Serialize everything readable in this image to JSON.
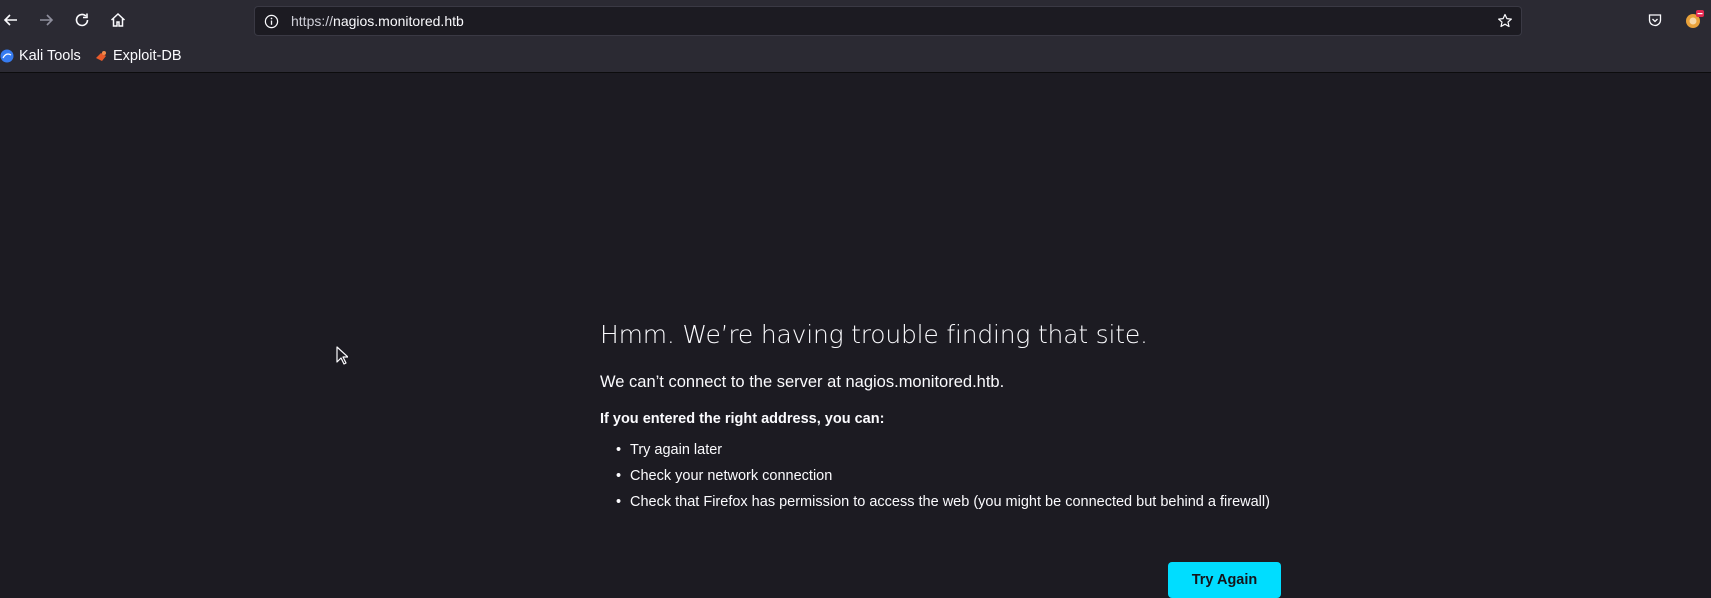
{
  "browser": {
    "url_prefix": "https://",
    "url_host": "nagios.monitored.htb",
    "icons": [
      "back-icon",
      "forward-icon",
      "reload-icon",
      "home-icon",
      "info-icon",
      "star-icon",
      "pocket-icon",
      "extension-icon"
    ]
  },
  "bookmarks": [
    {
      "label": "Kali Tools",
      "icon": "kali-icon"
    },
    {
      "label": "Exploit-DB",
      "icon": "exploitdb-icon"
    }
  ],
  "error": {
    "title": "Hmm. We’re having trouble finding that site.",
    "lead": "We can’t connect to the server at nagios.monitored.htb.",
    "instructions": "If you entered the right address, you can:",
    "tips": [
      "Try again later",
      "Check your network connection",
      "Check that Firefox has permission to access the web (you might be connected but behind a firewall)"
    ],
    "button": "Try Again"
  },
  "colors": {
    "page_bg": "#1c1b22",
    "toolbar_bg": "#2b2a33",
    "accent": "#00ddff"
  }
}
